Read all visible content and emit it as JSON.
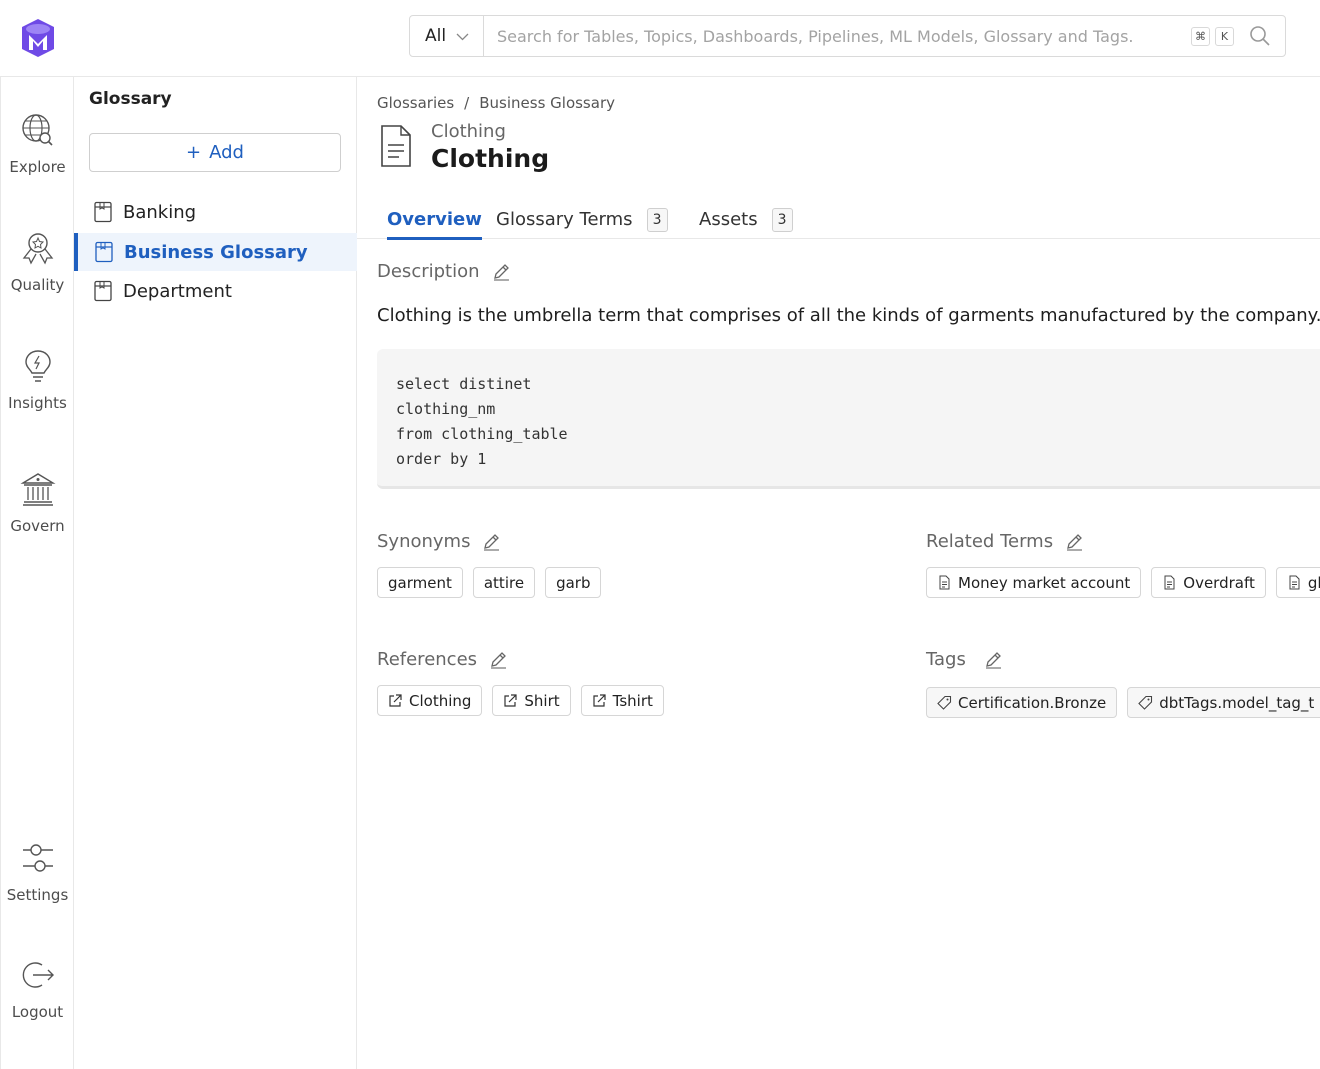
{
  "search": {
    "scope": "All",
    "placeholder": "Search for Tables, Topics, Dashboards, Pipelines, ML Models, Glossary and Tags.",
    "shortcut_cmd": "⌘",
    "shortcut_key": "K"
  },
  "rail": {
    "explore": "Explore",
    "quality": "Quality",
    "insights": "Insights",
    "govern": "Govern",
    "settings": "Settings",
    "logout": "Logout"
  },
  "glossary_panel": {
    "title": "Glossary",
    "add_label": "Add",
    "items": [
      {
        "label": "Banking"
      },
      {
        "label": "Business Glossary"
      },
      {
        "label": "Department"
      }
    ]
  },
  "breadcrumb": [
    "Glossaries",
    "/",
    "Business Glossary"
  ],
  "entity": {
    "subtitle": "Clothing",
    "title": "Clothing"
  },
  "tabs": [
    {
      "label": "Overview"
    },
    {
      "label": "Glossary Terms",
      "count": "3"
    },
    {
      "label": "Assets",
      "count": "3"
    }
  ],
  "description": {
    "label": "Description",
    "text": "Clothing is the umbrella term that comprises of all the kinds of garments manufactured by the company.",
    "code": "select distinet\nclothing_nm\nfrom clothing_table\norder by 1"
  },
  "synonyms": {
    "label": "Synonyms",
    "items": [
      "garment",
      "attire",
      "garb"
    ]
  },
  "related_terms": {
    "label": "Related Terms",
    "items": [
      "Money market account",
      "Overdraft",
      "gl"
    ]
  },
  "references": {
    "label": "References",
    "items": [
      "Clothing",
      "Shirt",
      "Tshirt"
    ]
  },
  "tags": {
    "label": "Tags",
    "items": [
      "Certification.Bronze",
      "dbtTags.model_tag_t"
    ]
  },
  "colors": {
    "accent": "#1f5fbf",
    "logo": "#7147e8"
  }
}
